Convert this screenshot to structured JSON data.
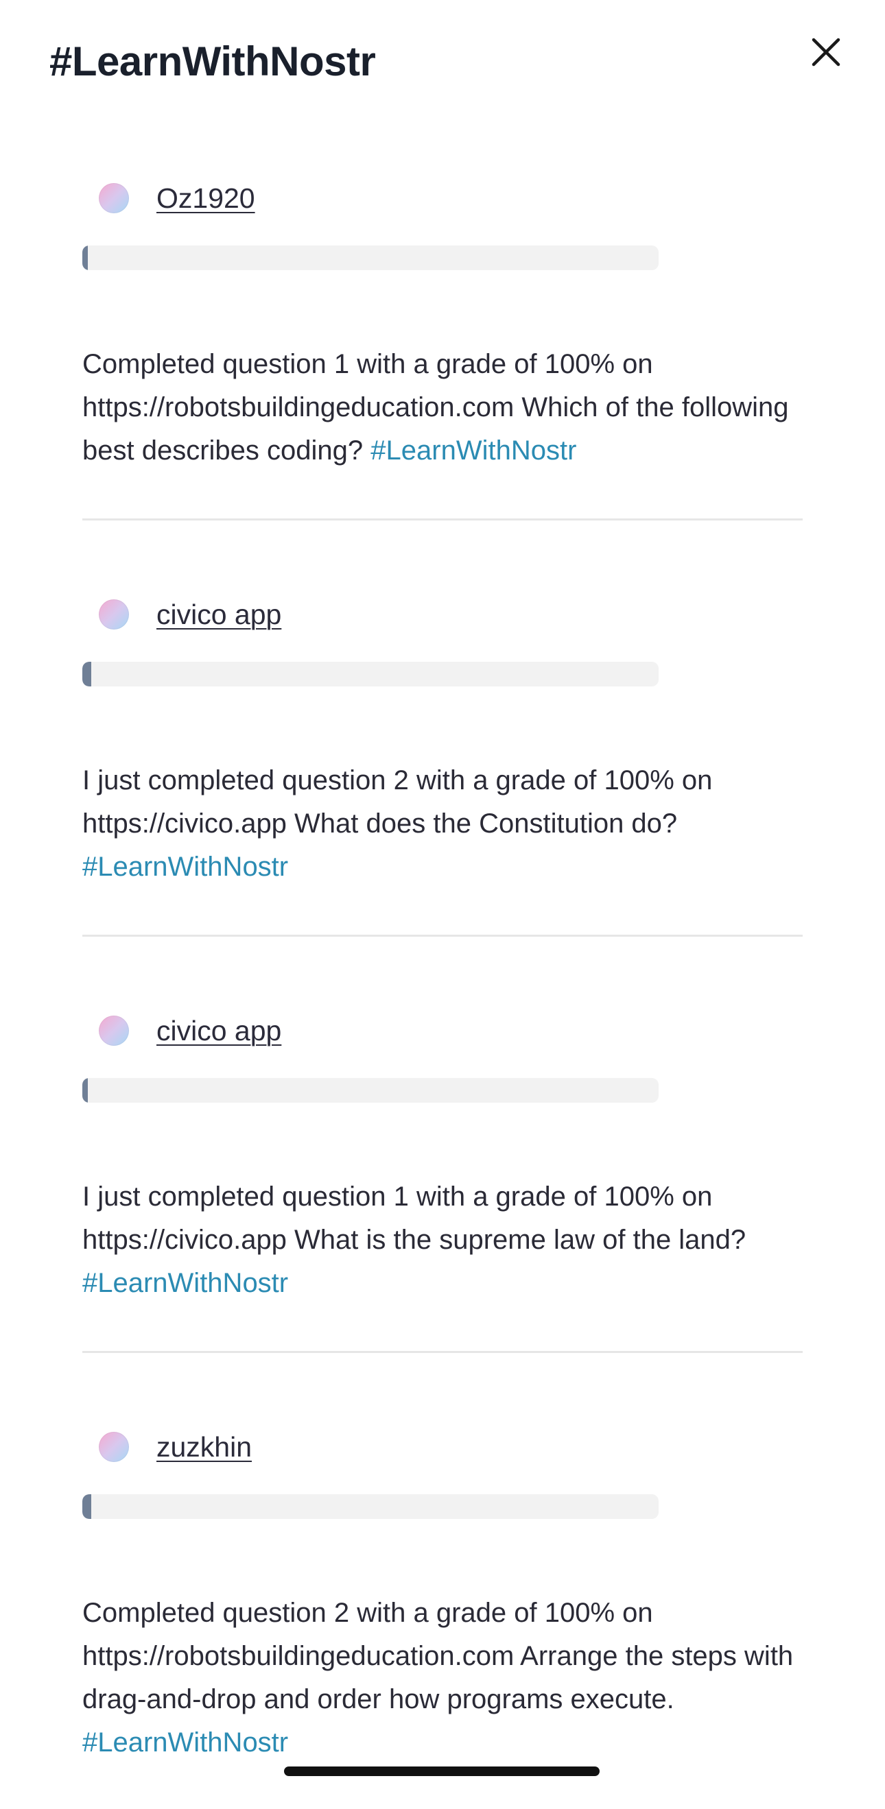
{
  "modal": {
    "title": "#LearnWithNostr"
  },
  "posts": [
    {
      "author": "Oz1920",
      "progress": 0.01,
      "text": "Completed question 1 with a grade of 100% on https://robotsbuildingeducation.com Which of the following best describes coding? ",
      "hashtag": "#LearnWithNostr"
    },
    {
      "author": "civico app",
      "progress": 0.015,
      "text": "I just completed question 2 with a grade of 100% on https://civico.app What does the Constitution do? ",
      "hashtag": "#LearnWithNostr"
    },
    {
      "author": "civico app",
      "progress": 0.008,
      "text": "I just completed question 1 with a grade of 100% on https://civico.app What is the supreme law of the land? ",
      "hashtag": "#LearnWithNostr"
    },
    {
      "author": "zuzkhin",
      "progress": 0.015,
      "text": "Completed question 2 with a grade of 100% on https://robotsbuildingeducation.com Arrange the steps with drag-and-drop and order how programs execute. ",
      "hashtag": "#LearnWithNostr"
    }
  ],
  "colors": {
    "hashtag": "#2b8bb3",
    "progress_fill": "#6f7f96",
    "progress_track": "#f2f2f2"
  }
}
